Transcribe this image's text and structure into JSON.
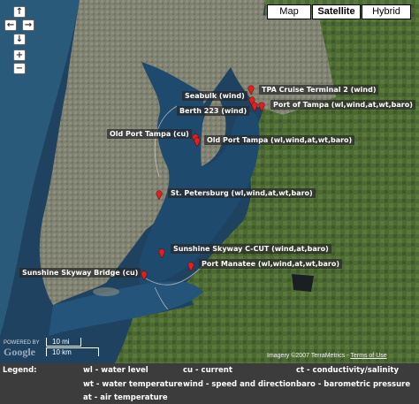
{
  "map_type_buttons": [
    "Map",
    "Satellite",
    "Hybrid"
  ],
  "active_map_type": "Satellite",
  "nav_controls": {
    "up": "↑",
    "left": "←",
    "right": "→",
    "down": "↓",
    "zoom_in": "+",
    "zoom_out": "−"
  },
  "stations": [
    {
      "label": "TPA Cruise Terminal 2 (wind)"
    },
    {
      "label": "Seabulk (wind)"
    },
    {
      "label": "Port of Tampa (wl,wind,at,wt,baro)"
    },
    {
      "label": "Berth 223 (wind)"
    },
    {
      "label": "Old Port Tampa (cu)"
    },
    {
      "label": "Old Port Tampa (wl,wind,at,wt,baro)"
    },
    {
      "label": "St. Petersburg (wl,wind,at,wt,baro)"
    },
    {
      "label": "Sunshine Skyway C-CUT (wind,at,baro)"
    },
    {
      "label": "Port Manatee (wl,wind,at,wt,baro)"
    },
    {
      "label": "Sunshine Skyway Bridge (cu)"
    }
  ],
  "scale": {
    "miles": "10 mi",
    "km": "10 km"
  },
  "powered_by": "POWERED BY",
  "google_logo": "Google",
  "copyright": "Imagery ©2007 TerraMetrics",
  "terms": "Terms of Use",
  "legend": {
    "title": "Legend:",
    "items": [
      "wl - water level",
      "cu - current",
      "ct - conductivity/salinity",
      "wt - water temperature",
      "wind - speed and direction",
      "baro - barometric pressure",
      "at - air temperature"
    ]
  },
  "colors": {
    "water": "#233c5c",
    "land": "#4f6a3c",
    "pin": "#e02020",
    "legend_bg": "#3c3c3c"
  }
}
